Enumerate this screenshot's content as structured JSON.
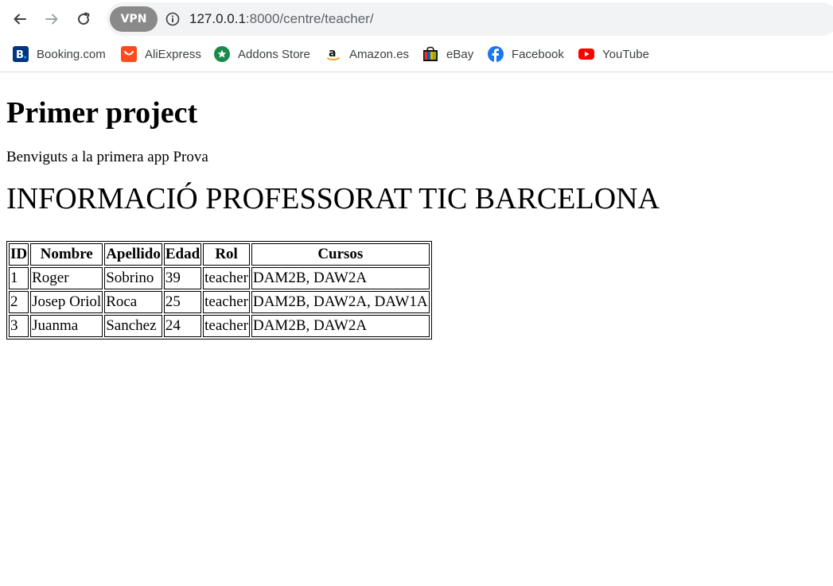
{
  "browser": {
    "url_host": "127.0.0.1",
    "url_rest": ":8000/centre/teacher/",
    "vpn_label": "VPN",
    "bookmarks": [
      {
        "label": "Booking.com",
        "icon": "booking-icon"
      },
      {
        "label": "AliExpress",
        "icon": "aliexpress-icon"
      },
      {
        "label": "Addons Store",
        "icon": "addons-store-icon"
      },
      {
        "label": "Amazon.es",
        "icon": "amazon-icon"
      },
      {
        "label": "eBay",
        "icon": "ebay-icon"
      },
      {
        "label": "Facebook",
        "icon": "facebook-icon"
      },
      {
        "label": "YouTube",
        "icon": "youtube-icon"
      }
    ]
  },
  "page": {
    "title": "Primer project",
    "intro": "Benviguts a la primera app Prova",
    "heading": "INFORMACIÓ PROFESSORAT TIC BARCELONA",
    "table": {
      "headers": [
        "ID",
        "Nombre",
        "Apellido",
        "Edad",
        "Rol",
        "Cursos"
      ],
      "rows": [
        [
          "1",
          "Roger",
          "Sobrino",
          "39",
          "teacher",
          "DAM2B, DAW2A"
        ],
        [
          "2",
          "Josep Oriol",
          "Roca",
          "25",
          "teacher",
          "DAM2B, DAW2A, DAW1A"
        ],
        [
          "3",
          "Juanma",
          "Sanchez",
          "24",
          "teacher",
          "DAM2B, DAW2A"
        ]
      ]
    }
  }
}
